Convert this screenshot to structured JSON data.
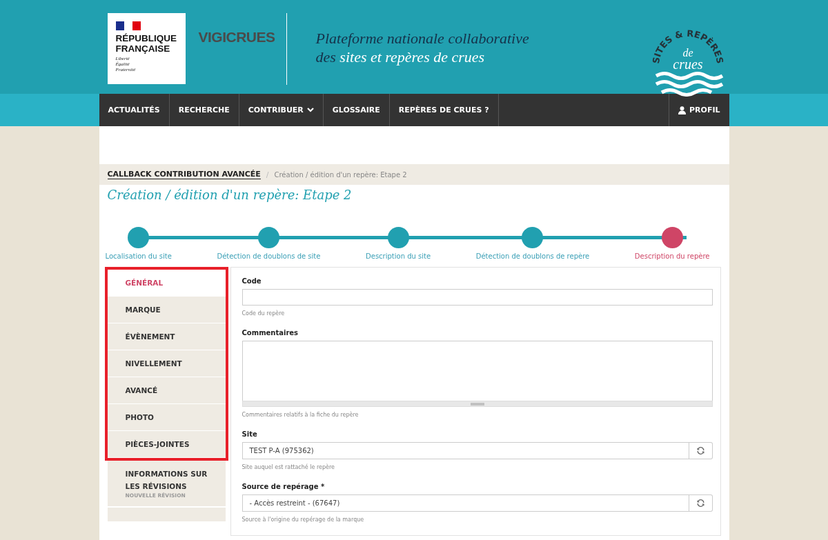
{
  "header": {
    "logo_lines": [
      "RÉPUBLIQUE",
      "FRANÇAISE"
    ],
    "motto": [
      "Liberté",
      "Égalité",
      "Fraternité"
    ],
    "brand": "VIGICRUES",
    "tagline_line1": "Plateforme nationale collaborative",
    "tagline_prefix": "des ",
    "tagline_emphasis": "sites et repères de crues",
    "badge_arc": "SITES & REPÈRES",
    "badge_de": "de",
    "badge_crues": "crues"
  },
  "nav": {
    "items": [
      {
        "label": "ACTUALITÉS",
        "has_menu": false
      },
      {
        "label": "RECHERCHE",
        "has_menu": false
      },
      {
        "label": "CONTRIBUER",
        "has_menu": true
      },
      {
        "label": "GLOSSAIRE",
        "has_menu": false
      },
      {
        "label": "REPÈRES DE CRUES ?",
        "has_menu": false
      }
    ],
    "profile": "PROFIL"
  },
  "breadcrumb": {
    "parent": "CALLBACK CONTRIBUTION AVANCÉE",
    "separator": "/",
    "current": "Création / édition d'un repère: Etape 2"
  },
  "title": "Création / édition d'un repère: Etape 2",
  "steps": [
    {
      "label": "Localisation du site",
      "selected": false
    },
    {
      "label": "Détection de doublons de site",
      "selected": false
    },
    {
      "label": "Description du site",
      "selected": false
    },
    {
      "label": "Détection de doublons de repère",
      "selected": false
    },
    {
      "label": "Description du repère",
      "selected": true
    }
  ],
  "tabs": [
    {
      "label": "GÉNÉRAL",
      "selected": true,
      "highlighted": true
    },
    {
      "label": "MARQUE",
      "selected": false,
      "highlighted": true
    },
    {
      "label": "ÉVÈNEMENT",
      "selected": false,
      "highlighted": true
    },
    {
      "label": "NIVELLEMENT",
      "selected": false,
      "highlighted": true
    },
    {
      "label": "AVANCÉ",
      "selected": false,
      "highlighted": true
    },
    {
      "label": "PHOTO",
      "selected": false,
      "highlighted": true
    },
    {
      "label": "PIÈCES-JOINTES",
      "selected": false,
      "highlighted": true
    },
    {
      "label": "INFORMATIONS SUR LES RÉVISIONS",
      "sublabel": "NOUVELLE RÉVISION",
      "selected": false,
      "highlighted": false
    }
  ],
  "fields": [
    {
      "kind": "text",
      "label": "Code",
      "help": "Code du repère"
    },
    {
      "kind": "textarea",
      "label": "Commentaires",
      "help": "Commentaires relatifs à la fiche du repère"
    },
    {
      "kind": "picker",
      "label": "Site",
      "value": "TEST P-A (975362)",
      "help": "Site auquel est rattaché le repère"
    },
    {
      "kind": "picker",
      "label": "Source de repérage *",
      "value": "- Accès restreint - (67647)",
      "help": "Source à l'origine du repérage de la marque"
    }
  ]
}
